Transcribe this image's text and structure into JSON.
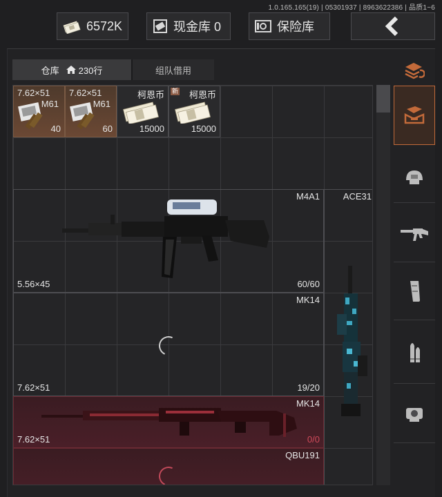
{
  "header": {
    "version": "1.0.165.165(19) | 05301937 | 8963622386 | 品质1~6",
    "money": "6572K",
    "cash_vault": "现金库 0",
    "safe": "保险库"
  },
  "tabs": {
    "warehouse_label": "仓库",
    "warehouse_count": "230行",
    "team_borrow": "组队借用"
  },
  "items": {
    "ammo1": {
      "caliber": "7.62×51",
      "name": "M61",
      "count": "40"
    },
    "ammo2": {
      "caliber": "7.62×51",
      "name": "M61",
      "count": "60"
    },
    "cash1": {
      "name": "柯恩币",
      "count": "15000"
    },
    "cash2": {
      "name": "柯恩币",
      "count": "15000",
      "badge": "新"
    },
    "m4a1": {
      "name": "M4A1",
      "caliber": "5.56×45",
      "ammo": "60/60"
    },
    "ace31": {
      "name": "ACE31"
    },
    "mk14_a": {
      "name": "MK14",
      "caliber": "7.62×51",
      "ammo": "19/20"
    },
    "mk14_b": {
      "name": "MK14",
      "caliber": "7.62×51",
      "ammo": "0/0"
    },
    "qbu191": {
      "name": "QBU191"
    }
  },
  "colors": {
    "accent": "#c36a3a",
    "ammo_bg": "#5a4030",
    "red_slot": "#441e26",
    "empty_ammo": "#d04a5a"
  },
  "icons": [
    "money-icon",
    "cash-vault-icon",
    "safe-icon",
    "back-arrow-icon",
    "home-icon",
    "loading-spinner-icon",
    "layers-icon",
    "tray-icon",
    "helmet-icon",
    "rifle-icon",
    "magazine-icon",
    "bullets-icon",
    "scope-icon"
  ]
}
